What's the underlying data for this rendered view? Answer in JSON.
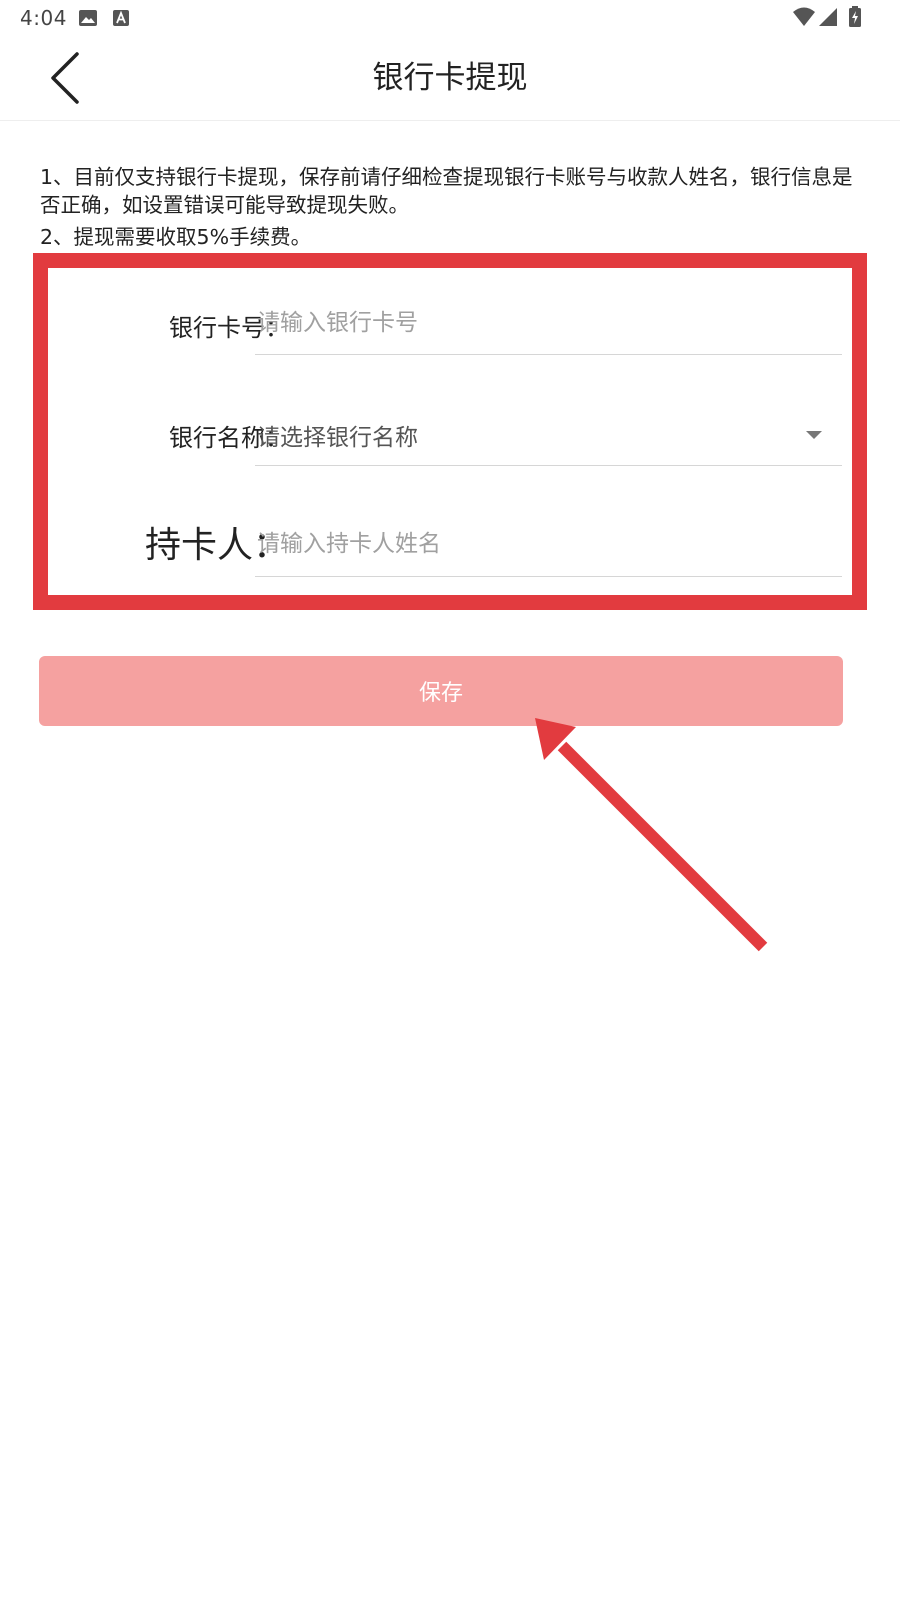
{
  "status_bar": {
    "time": "4:04"
  },
  "header": {
    "title": "银行卡提现",
    "back_icon": "chevron-left-icon"
  },
  "notice": {
    "line1": "1、目前仅支持银行卡提现，保存前请仔细检查提现银行卡账号与收款人姓名，银行信息是否正确，如设置错误可能导致提现失败。",
    "line2": "2、提现需要收取5%手续费。"
  },
  "form": {
    "card_number": {
      "label": "银行卡号：",
      "placeholder": "请输入银行卡号",
      "value": ""
    },
    "bank_name": {
      "label": "银行名称：",
      "selected": "请选择银行名称"
    },
    "card_holder": {
      "label": "持卡人：",
      "placeholder": "请输入持卡人姓名",
      "value": ""
    }
  },
  "save_button": {
    "label": "保存"
  },
  "colors": {
    "highlight": "#e23b3f",
    "button_bg": "#f5a1a0",
    "button_text": "#ffffff"
  }
}
